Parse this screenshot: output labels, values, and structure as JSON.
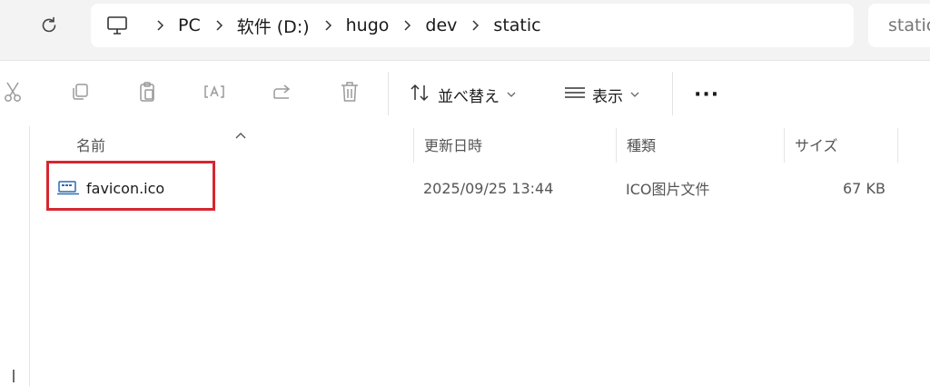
{
  "address_bar": {
    "segments": [
      "PC",
      "软件 (D:)",
      "hugo",
      "dev",
      "static"
    ],
    "icons": {
      "refresh": "refresh-icon",
      "root": "monitor-icon",
      "separator": "chevron-right-icon"
    }
  },
  "search": {
    "text": "static"
  },
  "toolbar": {
    "buttons": [
      {
        "name": "cut",
        "icon": "scissors-icon"
      },
      {
        "name": "copy",
        "icon": "copy-icon"
      },
      {
        "name": "paste",
        "icon": "clipboard-icon"
      },
      {
        "name": "rename",
        "icon": "rename-icon"
      },
      {
        "name": "share",
        "icon": "share-icon"
      },
      {
        "name": "delete",
        "icon": "trash-icon"
      }
    ],
    "sort_label": "並べ替え",
    "view_label": "表示",
    "more_label": "···"
  },
  "columns": {
    "name": "名前",
    "modified": "更新日時",
    "type": "種類",
    "size": "サイズ"
  },
  "files": [
    {
      "name": "favicon.ico",
      "modified": "2025/09/25 13:44",
      "type": "ICO图片文件",
      "size": "67 KB",
      "icon": "ico-file-icon",
      "highlighted": true
    }
  ],
  "colors": {
    "highlight_border": "#d7262f",
    "topbar_bg": "#f3f3f3"
  }
}
